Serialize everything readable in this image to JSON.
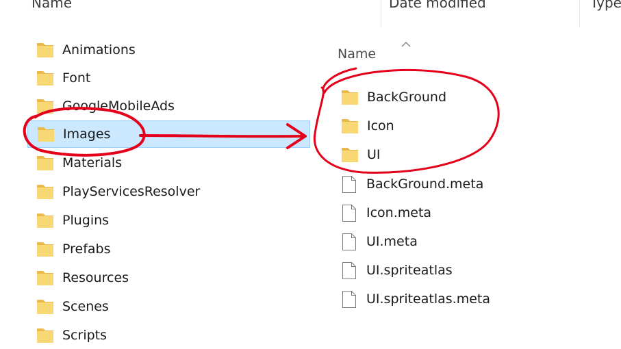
{
  "columns": {
    "name": "Name",
    "date_modified": "Date modified",
    "type": "Type"
  },
  "left_pane": {
    "items": [
      {
        "label": "Animations"
      },
      {
        "label": "Font"
      },
      {
        "label": "GoogleMobileAds"
      },
      {
        "label": "Images",
        "selected": true
      },
      {
        "label": "Materials"
      },
      {
        "label": "PlayServicesResolver"
      },
      {
        "label": "Plugins"
      },
      {
        "label": "Prefabs"
      },
      {
        "label": "Resources"
      },
      {
        "label": "Scenes"
      },
      {
        "label": "Scripts"
      }
    ]
  },
  "right_pane": {
    "header": "Name",
    "folders": [
      {
        "label": "BackGround"
      },
      {
        "label": "Icon"
      },
      {
        "label": "UI"
      }
    ],
    "files": [
      {
        "label": "BackGround.meta"
      },
      {
        "label": "Icon.meta"
      },
      {
        "label": "UI.meta"
      },
      {
        "label": "UI.spriteatlas"
      },
      {
        "label": "UI.spriteatlas.meta"
      }
    ]
  },
  "colors": {
    "folder": "#f8d775",
    "folder_dark": "#e9b949",
    "selection_bg": "#cce8ff",
    "selection_border": "#99d1ff",
    "annotation": "#e4001b"
  },
  "icons": {
    "folder": "folder-icon",
    "file": "file-icon",
    "sort": "sort-up-icon"
  }
}
